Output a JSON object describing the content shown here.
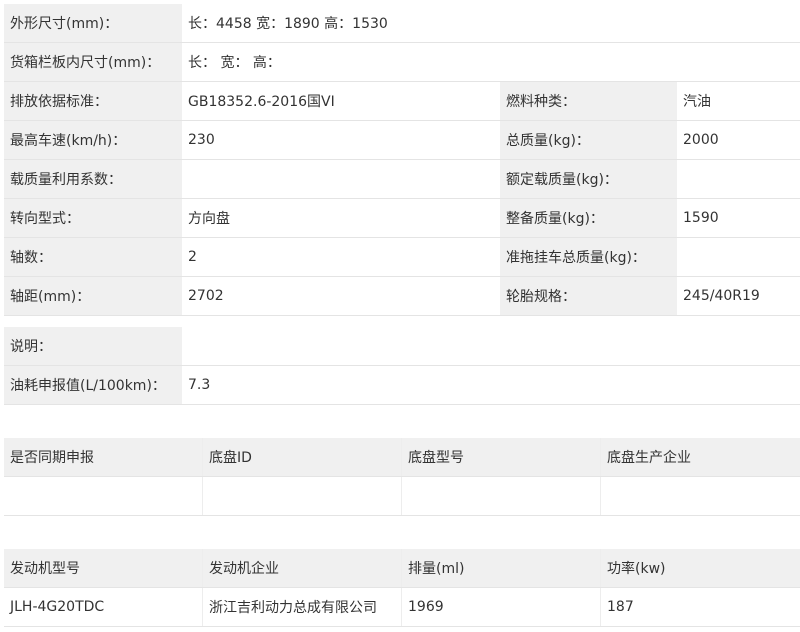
{
  "specs": {
    "rows": [
      {
        "label1": "外形尺寸(mm)：",
        "value1": "长：4458 宽：1890 高：1530"
      },
      {
        "label1": "货箱栏板内尺寸(mm)：",
        "value1": "长：  宽：  高："
      },
      {
        "label1": "排放依据标准：",
        "value1": "GB18352.6-2016国VI",
        "label2": "燃料种类：",
        "value2": "汽油"
      },
      {
        "label1": "最高车速(km/h)：",
        "value1": "230",
        "label2": "总质量(kg)：",
        "value2": "2000"
      },
      {
        "label1": "载质量利用系数：",
        "value1": "",
        "label2": "额定载质量(kg)：",
        "value2": ""
      },
      {
        "label1": "转向型式：",
        "value1": "方向盘",
        "label2": "整备质量(kg)：",
        "value2": "1590"
      },
      {
        "label1": "轴数：",
        "value1": "2",
        "label2": "准拖挂车总质量(kg)：",
        "value2": ""
      },
      {
        "label1": "轴距(mm)：",
        "value1": "2702",
        "label2": "轮胎规格：",
        "value2": "245/40R19"
      }
    ]
  },
  "notes": {
    "description_label": "说明：",
    "description_value": "",
    "fuel_label": "油耗申报值(L/100km)：",
    "fuel_value": "7.3"
  },
  "chassis": {
    "headers": [
      "是否同期申报",
      "底盘ID",
      "底盘型号",
      "底盘生产企业"
    ],
    "values": [
      "",
      "",
      "",
      ""
    ]
  },
  "engine": {
    "headers": [
      "发动机型号",
      "发动机企业",
      "排量(ml)",
      "功率(kw)"
    ],
    "values": [
      "JLH-4G20TDC",
      "浙江吉利动力总成有限公司",
      "1969",
      "187"
    ]
  }
}
